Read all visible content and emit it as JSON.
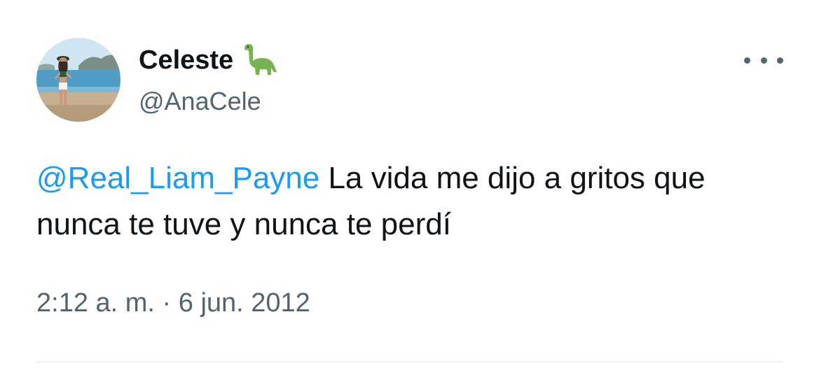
{
  "tweet": {
    "author": {
      "display_name": "Celeste",
      "name_emoji": "sauropod-dinosaur-icon",
      "handle": "@AnaCele",
      "avatar": "beach-photo-avatar"
    },
    "more_icon": "more-horizontal-icon",
    "mention": "@Real_Liam_Payne",
    "text": " La vida me dijo a gritos que nunca te tuve y nunca te perdí",
    "timestamp": "2:12 a. m. · 6 jun. 2012"
  },
  "colors": {
    "text": "#0f1419",
    "secondary": "#536471",
    "link": "#1d9bf0",
    "divider": "#eff3f4"
  }
}
